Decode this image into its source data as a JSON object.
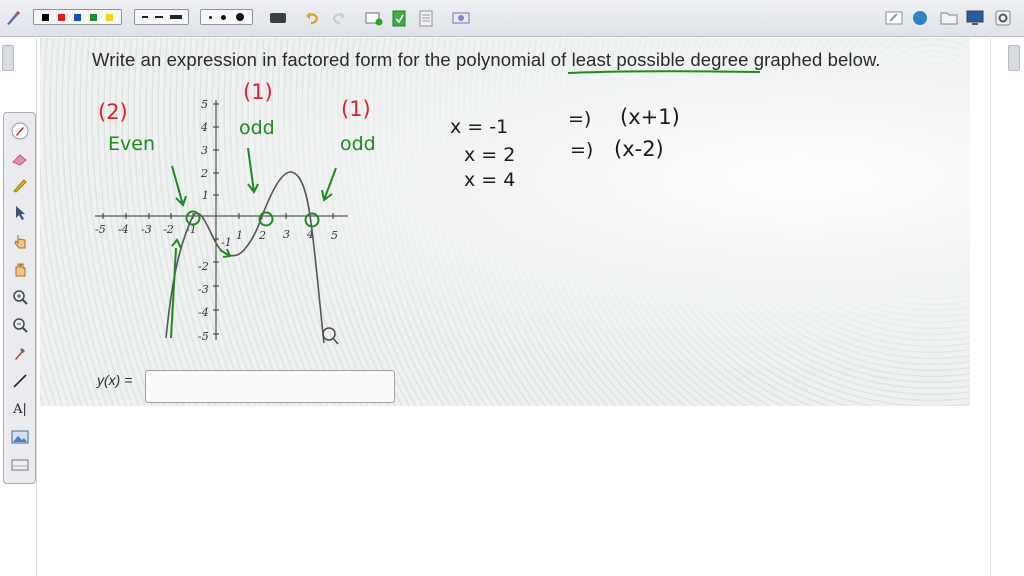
{
  "toolbar": {
    "pen_colors": [
      "#000000",
      "#e02020",
      "#1a4fb8",
      "#1b8f2b",
      "#f2d21a"
    ],
    "line_styles": [
      "dashed",
      "long-dashed",
      "solid"
    ],
    "dot_sizes": [
      "small",
      "medium",
      "large"
    ],
    "icons": [
      "pen-tool-icon",
      "keyboard-icon",
      "undo-icon",
      "redo-icon",
      "add-page-icon",
      "green-page-icon",
      "page-icon",
      "screen-capture-icon",
      "eraser-board-icon",
      "globe-icon",
      "folder-icon",
      "monitor-icon",
      "settings-icon"
    ]
  },
  "palette": {
    "tools": [
      "pen-icon",
      "eraser-icon",
      "highlighter-icon",
      "pointer-icon",
      "hand-pointer-icon",
      "hand-icon",
      "zoom-in-icon",
      "zoom-out-icon",
      "dropper-icon",
      "line-icon",
      "text-tool-icon",
      "image-icon",
      "board-icon"
    ],
    "text_tool_label": "A|"
  },
  "problem": {
    "prompt": "Write an expression in factored form for the polynomial of least possible degree graphed below.",
    "answer_label": "y(x) ="
  },
  "graph": {
    "x_ticks": [
      "-5",
      "-4",
      "-3",
      "-2",
      "-1",
      "1",
      "2",
      "3",
      "4",
      "5"
    ],
    "y_ticks": [
      "5",
      "4",
      "3",
      "2",
      "1",
      "-1",
      "-2",
      "-3",
      "-4",
      "-5"
    ]
  },
  "annotations": {
    "mult_left": "(2)",
    "mult_mid": "(1)",
    "mult_right": "(1)",
    "label_left": "Even",
    "label_mid": "odd",
    "label_right": "odd",
    "roots": [
      "x = -1",
      "x = 2",
      "x = 4"
    ],
    "arrows": [
      "=)",
      "=)"
    ],
    "factors": [
      "(x+1)",
      "(x-2)"
    ]
  },
  "colors": {
    "ink_black": "#1a1a1a",
    "ink_red": "#e0202a",
    "ink_green": "#1f8a1f",
    "toolbar_bg": "#e4e7eb"
  }
}
